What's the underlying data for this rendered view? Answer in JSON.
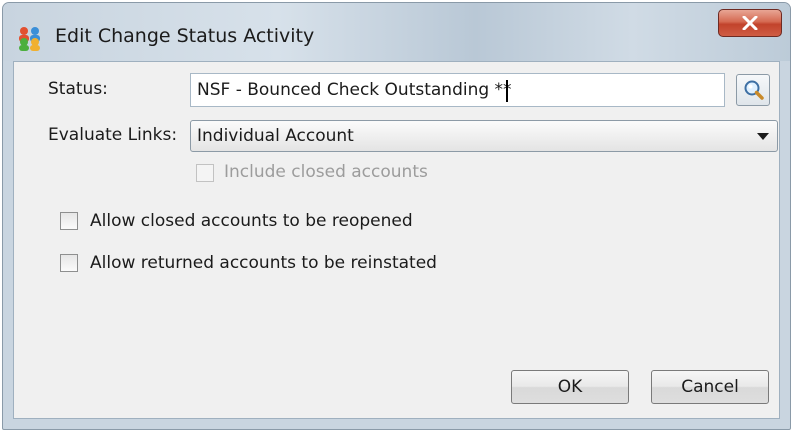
{
  "window": {
    "title": "Edit Change Status Activity",
    "icons": {
      "app": "people-status-icon",
      "close": "close-icon",
      "lookup": "magnifier-icon",
      "dropdown": "chevron-down-icon"
    }
  },
  "form": {
    "status_label": "Status:",
    "status_value": "NSF - Bounced Check Outstanding **",
    "evaluate_links_label": "Evaluate Links:",
    "evaluate_links_value": "Individual Account",
    "include_closed_label": "Include closed accounts",
    "include_closed_checked": false,
    "include_closed_enabled": false,
    "allow_reopen_label": "Allow closed accounts to be reopened",
    "allow_reopen_checked": false,
    "allow_reinstate_label": "Allow returned accounts to be reinstated",
    "allow_reinstate_checked": false
  },
  "buttons": {
    "ok": "OK",
    "cancel": "Cancel"
  },
  "colors": {
    "close_button": "#c9503a",
    "dialog_background": "#f0f0f0",
    "frame": "#c9d5e0"
  }
}
